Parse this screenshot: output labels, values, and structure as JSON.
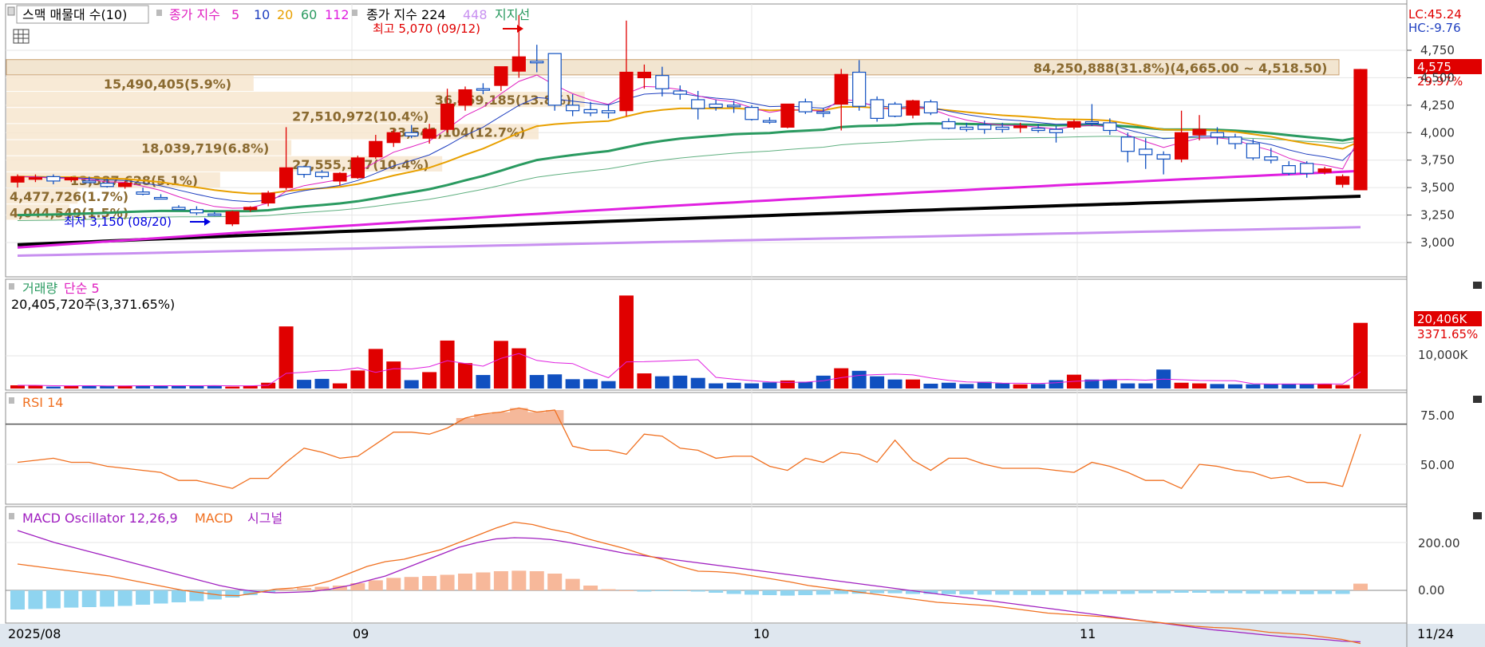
{
  "legend": {
    "box_label": "스맥 매물대 수(10)",
    "ma_prefix": "종가 지수",
    "ma_periods": [
      {
        "label": "5",
        "color": "#e020c0"
      },
      {
        "label": "10",
        "color": "#2040c0"
      },
      {
        "label": "20",
        "color": "#e8a000"
      },
      {
        "label": "60",
        "color": "#2a9a60"
      },
      {
        "label": "112",
        "color": "#e020e0"
      }
    ],
    "ma2_prefix": "종가 지수 224",
    "ma2_period448": "448",
    "support_label": "지지선",
    "color_224": "#000000",
    "color_448": "#c890f0"
  },
  "price_axis": {
    "ticks": [
      "4,750",
      "4,500",
      "4,250",
      "4,000",
      "3,750",
      "3,500",
      "3,250",
      "3,000"
    ],
    "lc_label": "LC:45.24",
    "hc_label": "HC:-9.76",
    "current_price": "4,575",
    "change_pct": "29.97%"
  },
  "annotations": {
    "high": "최고 5,070 (09/12)",
    "low": "최저 3,150 (08/20)"
  },
  "volume_profile": [
    {
      "label": "84,250,888(31.8%)(4,665.00 ~ 4,518.50)",
      "price_hi": 4665,
      "price_lo": 4518.5,
      "share": 31.8
    },
    {
      "label": "15,490,405(5.9%)",
      "price_hi": 4518.5,
      "price_lo": 4372,
      "share": 5.9
    },
    {
      "label": "36,469,185(13.8%)",
      "price_hi": 4372,
      "price_lo": 4225.5,
      "share": 13.8
    },
    {
      "label": "27,510,972(10.4%)",
      "price_hi": 4225.5,
      "price_lo": 4079,
      "share": 10.4
    },
    {
      "label": "33,541,104(12.7%)",
      "price_hi": 4079,
      "price_lo": 3932.5,
      "share": 12.7
    },
    {
      "label": "18,039,719(6.8%)",
      "price_hi": 3932.5,
      "price_lo": 3786,
      "share": 6.8
    },
    {
      "label": "27,555,117(10.4%)",
      "price_hi": 3786,
      "price_lo": 3639.5,
      "share": 10.4
    },
    {
      "label": "13,387,628(5.1%)",
      "price_hi": 3639.5,
      "price_lo": 3493,
      "share": 5.1
    },
    {
      "label": "4,477,726(1.7%)",
      "price_hi": 3493,
      "price_lo": 3346.5,
      "share": 1.7
    },
    {
      "label": "4,044,549(1.5%)",
      "price_hi": 3346.5,
      "price_lo": 3200,
      "share": 1.5
    }
  ],
  "volume_panel": {
    "title": "거래량",
    "ma_label": "단순 5",
    "summary": "20,405,720주(3,371.65%)",
    "tick": "10,000K",
    "current": "20,406K",
    "current_pct": "3371.65%"
  },
  "rsi_panel": {
    "title": "RSI 14",
    "ticks": [
      "75.00",
      "50.00"
    ]
  },
  "macd_panel": {
    "title_osc": "MACD Oscillator 12,26,9",
    "title_macd": "MACD",
    "title_signal": "시그널",
    "ticks": [
      "200.00",
      "0.00"
    ]
  },
  "x_axis": {
    "labels": [
      "2025/08",
      "09",
      "10",
      "11"
    ],
    "last_label": "11/24"
  },
  "chart_data": {
    "type": "candlestick",
    "y_range": [
      2850,
      5100
    ],
    "candles": [
      {
        "o": 3550,
        "h": 3620,
        "l": 3500,
        "c": 3600
      },
      {
        "o": 3580,
        "h": 3620,
        "l": 3550,
        "c": 3590
      },
      {
        "o": 3600,
        "h": 3620,
        "l": 3530,
        "c": 3560
      },
      {
        "o": 3570,
        "h": 3600,
        "l": 3550,
        "c": 3590
      },
      {
        "o": 3560,
        "h": 3600,
        "l": 3540,
        "c": 3550
      },
      {
        "o": 3540,
        "h": 3580,
        "l": 3500,
        "c": 3510
      },
      {
        "o": 3510,
        "h": 3560,
        "l": 3490,
        "c": 3540
      },
      {
        "o": 3460,
        "h": 3500,
        "l": 3430,
        "c": 3440
      },
      {
        "o": 3410,
        "h": 3440,
        "l": 3400,
        "c": 3400
      },
      {
        "o": 3320,
        "h": 3340,
        "l": 3300,
        "c": 3300
      },
      {
        "o": 3300,
        "h": 3330,
        "l": 3250,
        "c": 3270
      },
      {
        "o": 3260,
        "h": 3280,
        "l": 3240,
        "c": 3250
      },
      {
        "o": 3170,
        "h": 3290,
        "l": 3150,
        "c": 3280
      },
      {
        "o": 3300,
        "h": 3330,
        "l": 3280,
        "c": 3320
      },
      {
        "o": 3360,
        "h": 3470,
        "l": 3330,
        "c": 3450
      },
      {
        "o": 3500,
        "h": 4050,
        "l": 3480,
        "c": 3680
      },
      {
        "o": 3690,
        "h": 3700,
        "l": 3590,
        "c": 3620
      },
      {
        "o": 3640,
        "h": 3660,
        "l": 3580,
        "c": 3600
      },
      {
        "o": 3560,
        "h": 3640,
        "l": 3520,
        "c": 3630
      },
      {
        "o": 3590,
        "h": 3790,
        "l": 3580,
        "c": 3770
      },
      {
        "o": 3780,
        "h": 3980,
        "l": 3760,
        "c": 3920
      },
      {
        "o": 3910,
        "h": 4030,
        "l": 3870,
        "c": 4000
      },
      {
        "o": 4000,
        "h": 4070,
        "l": 3950,
        "c": 3970
      },
      {
        "o": 3950,
        "h": 4080,
        "l": 3900,
        "c": 4030
      },
      {
        "o": 4030,
        "h": 4400,
        "l": 4000,
        "c": 4260
      },
      {
        "o": 4250,
        "h": 4420,
        "l": 4200,
        "c": 4390
      },
      {
        "o": 4400,
        "h": 4450,
        "l": 4350,
        "c": 4390
      },
      {
        "o": 4430,
        "h": 4600,
        "l": 4380,
        "c": 4600
      },
      {
        "o": 4560,
        "h": 5070,
        "l": 4500,
        "c": 4690
      },
      {
        "o": 4650,
        "h": 4800,
        "l": 4550,
        "c": 4640
      },
      {
        "o": 4720,
        "h": 4720,
        "l": 4200,
        "c": 4250
      },
      {
        "o": 4250,
        "h": 4350,
        "l": 4150,
        "c": 4200
      },
      {
        "o": 4210,
        "h": 4280,
        "l": 4150,
        "c": 4180
      },
      {
        "o": 4200,
        "h": 4260,
        "l": 4130,
        "c": 4180
      },
      {
        "o": 4200,
        "h": 5020,
        "l": 4150,
        "c": 4550
      },
      {
        "o": 4500,
        "h": 4620,
        "l": 4400,
        "c": 4550
      },
      {
        "o": 4520,
        "h": 4600,
        "l": 4330,
        "c": 4400
      },
      {
        "o": 4380,
        "h": 4430,
        "l": 4300,
        "c": 4350
      },
      {
        "o": 4300,
        "h": 4380,
        "l": 4120,
        "c": 4220
      },
      {
        "o": 4260,
        "h": 4300,
        "l": 4200,
        "c": 4230
      },
      {
        "o": 4250,
        "h": 4290,
        "l": 4180,
        "c": 4240
      },
      {
        "o": 4230,
        "h": 4250,
        "l": 4110,
        "c": 4120
      },
      {
        "o": 4110,
        "h": 4140,
        "l": 4080,
        "c": 4100
      },
      {
        "o": 4050,
        "h": 4250,
        "l": 4040,
        "c": 4260
      },
      {
        "o": 4280,
        "h": 4310,
        "l": 4170,
        "c": 4190
      },
      {
        "o": 4190,
        "h": 4220,
        "l": 4140,
        "c": 4180
      },
      {
        "o": 4260,
        "h": 4580,
        "l": 4020,
        "c": 4530
      },
      {
        "o": 4550,
        "h": 4660,
        "l": 4200,
        "c": 4240
      },
      {
        "o": 4300,
        "h": 4330,
        "l": 4100,
        "c": 4130
      },
      {
        "o": 4260,
        "h": 4280,
        "l": 4140,
        "c": 4150
      },
      {
        "o": 4160,
        "h": 4300,
        "l": 4130,
        "c": 4290
      },
      {
        "o": 4280,
        "h": 4300,
        "l": 4160,
        "c": 4180
      },
      {
        "o": 4100,
        "h": 4130,
        "l": 4030,
        "c": 4040
      },
      {
        "o": 4050,
        "h": 4090,
        "l": 4010,
        "c": 4030
      },
      {
        "o": 4070,
        "h": 4110,
        "l": 3990,
        "c": 4030
      },
      {
        "o": 4050,
        "h": 4090,
        "l": 4000,
        "c": 4030
      },
      {
        "o": 4050,
        "h": 4090,
        "l": 4000,
        "c": 4060
      },
      {
        "o": 4040,
        "h": 4080,
        "l": 4000,
        "c": 4020
      },
      {
        "o": 4030,
        "h": 4060,
        "l": 3910,
        "c": 4000
      },
      {
        "o": 4050,
        "h": 4120,
        "l": 4030,
        "c": 4100
      },
      {
        "o": 4100,
        "h": 4260,
        "l": 4060,
        "c": 4090
      },
      {
        "o": 4090,
        "h": 4130,
        "l": 3980,
        "c": 4020
      },
      {
        "o": 3960,
        "h": 4000,
        "l": 3730,
        "c": 3830
      },
      {
        "o": 3850,
        "h": 3950,
        "l": 3670,
        "c": 3800
      },
      {
        "o": 3800,
        "h": 3830,
        "l": 3620,
        "c": 3760
      },
      {
        "o": 3760,
        "h": 4200,
        "l": 3730,
        "c": 4000
      },
      {
        "o": 3980,
        "h": 4160,
        "l": 3930,
        "c": 4030
      },
      {
        "o": 4000,
        "h": 4050,
        "l": 3890,
        "c": 3960
      },
      {
        "o": 3960,
        "h": 3990,
        "l": 3850,
        "c": 3900
      },
      {
        "o": 3900,
        "h": 3940,
        "l": 3750,
        "c": 3770
      },
      {
        "o": 3780,
        "h": 3860,
        "l": 3720,
        "c": 3750
      },
      {
        "o": 3700,
        "h": 3740,
        "l": 3610,
        "c": 3630
      },
      {
        "o": 3720,
        "h": 3740,
        "l": 3590,
        "c": 3630
      },
      {
        "o": 3640,
        "h": 3690,
        "l": 3620,
        "c": 3670
      },
      {
        "o": 3530,
        "h": 3620,
        "l": 3500,
        "c": 3600
      },
      {
        "o": 3480,
        "h": 4580,
        "l": 3480,
        "c": 4575
      }
    ],
    "volume_k": [
      1000,
      1000,
      600,
      800,
      900,
      800,
      900,
      900,
      900,
      900,
      800,
      1000,
      600,
      900,
      1800,
      19300,
      2700,
      3000,
      1600,
      5600,
      12300,
      8400,
      2600,
      5100,
      14900,
      7900,
      4200,
      14800,
      12500,
      4200,
      4400,
      2900,
      2900,
      2300,
      28900,
      4700,
      3800,
      4000,
      3300,
      1600,
      1800,
      1600,
      1900,
      2500,
      2100,
      4000,
      6300,
      5500,
      3800,
      2800,
      2800,
      1500,
      1800,
      1400,
      2100,
      1600,
      1300,
      1400,
      2600,
      4300,
      2800,
      2700,
      1600,
      1600,
      5900,
      1800,
      1600,
      1400,
      1300,
      1300,
      1400,
      1500,
      1400,
      1500,
      1100,
      20406
    ],
    "rsi": [
      51,
      52,
      53,
      51,
      51,
      49,
      48,
      47,
      46,
      42,
      42,
      40,
      38,
      43,
      43,
      51,
      58,
      56,
      53,
      54,
      60,
      66,
      66,
      65,
      68,
      73,
      75,
      76,
      78,
      76,
      77,
      59,
      57,
      57,
      55,
      65,
      64,
      58,
      57,
      53,
      54,
      54,
      49,
      47,
      53,
      51,
      56,
      55,
      51,
      62,
      52,
      47,
      53,
      53,
      50,
      48,
      48,
      48,
      47,
      46,
      51,
      49,
      46,
      42,
      42,
      38,
      50,
      49,
      47,
      46,
      43,
      44,
      41,
      41,
      39,
      65
    ],
    "macd_osc": [
      -80,
      -78,
      -75,
      -72,
      -70,
      -68,
      -65,
      -60,
      -55,
      -50,
      -45,
      -38,
      -30,
      -20,
      -8,
      5,
      10,
      15,
      20,
      30,
      42,
      52,
      56,
      60,
      65,
      70,
      75,
      80,
      82,
      80,
      70,
      48,
      20,
      5,
      0,
      -5,
      -3,
      -2,
      -5,
      -10,
      -15,
      -18,
      -20,
      -22,
      -20,
      -18,
      -15,
      -14,
      -12,
      -12,
      -15,
      -15,
      -16,
      -17,
      -18,
      -18,
      -19,
      -19,
      -18,
      -18,
      -15,
      -15,
      -15,
      -12,
      -12,
      -10,
      -10,
      -12,
      -12,
      -14,
      -15,
      -15,
      -16,
      -15,
      -15,
      28
    ],
    "macd": [
      110,
      100,
      90,
      80,
      70,
      60,
      45,
      30,
      15,
      0,
      -10,
      -20,
      -22,
      -10,
      5,
      10,
      20,
      40,
      70,
      100,
      120,
      130,
      150,
      170,
      200,
      230,
      260,
      285,
      275,
      255,
      240,
      215,
      195,
      175,
      150,
      130,
      100,
      80,
      78,
      72,
      60,
      48,
      35,
      20,
      10,
      0,
      -10,
      -20,
      -30,
      -40,
      -50,
      -55,
      -60,
      -65,
      -75,
      -85,
      -95,
      -100,
      -105,
      -110,
      -118,
      -126,
      -134,
      -142,
      -150,
      -155,
      -158,
      -165,
      -175,
      -180,
      -185,
      -195,
      -205,
      -222
    ],
    "signal": [
      250,
      225,
      200,
      180,
      160,
      140,
      120,
      100,
      80,
      60,
      40,
      20,
      5,
      -5,
      -10,
      -8,
      -5,
      5,
      20,
      40,
      60,
      90,
      120,
      150,
      180,
      200,
      215,
      220,
      218,
      212,
      200,
      185,
      170,
      155,
      145,
      135,
      125,
      115,
      105,
      95,
      85,
      75,
      65,
      55,
      45,
      35,
      25,
      15,
      5,
      -5,
      -15,
      -25,
      -35,
      -45,
      -55,
      -65,
      -75,
      -85,
      -95,
      -105,
      -115,
      -125,
      -135,
      -145,
      -155,
      -165,
      -172,
      -180,
      -188,
      -195,
      -200,
      -205,
      -212,
      -215
    ]
  }
}
